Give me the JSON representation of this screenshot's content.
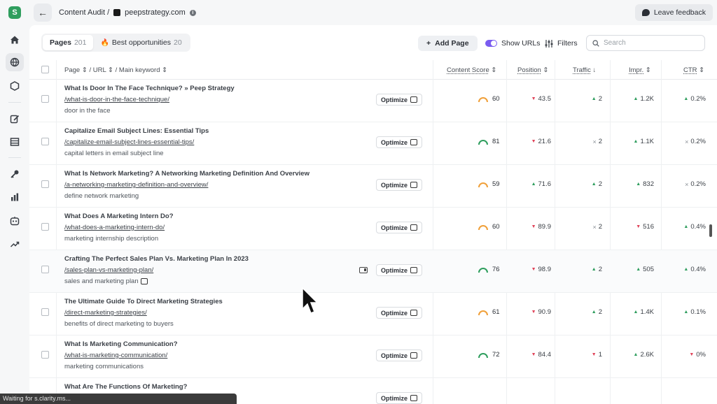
{
  "header": {
    "crumb_root": "Content Audit /",
    "site": "peepstrategy.com",
    "feedback_label": "Leave feedback"
  },
  "rail": {
    "logo_letter": "S",
    "icons": [
      "home-icon",
      "globe-icon",
      "hexagon-icon",
      "edit-icon",
      "table-icon",
      "key-icon",
      "bar-chart-icon",
      "robot-icon",
      "trend-icon"
    ]
  },
  "toolbar": {
    "tabs": [
      {
        "label": "Pages",
        "count": "201"
      },
      {
        "label": "Best opportunities",
        "count": "20"
      }
    ],
    "add_page": "Add Page",
    "show_urls": "Show URLs",
    "filters": "Filters",
    "search_placeholder": "Search"
  },
  "columns": {
    "page": "Page",
    "url": "/ URL",
    "keyword": "/ Main keyword",
    "content_score": "Content Score",
    "position": "Position",
    "traffic": "Traffic",
    "impr": "Impr.",
    "ctr": "CTR"
  },
  "optimize_label": "Optimize",
  "rows": [
    {
      "title": "What Is Door In The Face Technique? » Peep Strategy",
      "url": "/what-is-door-in-the-face-technique/",
      "keyword": "door in the face",
      "score": "60",
      "score_color": "#f0a03a",
      "position": "43.5",
      "pos_dir": "down",
      "traffic": "2",
      "traffic_dir": "up",
      "impr": "1.2K",
      "impr_dir": "up",
      "ctr": "0.2%",
      "ctr_dir": "up"
    },
    {
      "title": "Capitalize Email Subject Lines: Essential Tips",
      "url": "/capitalize-email-subject-lines-essential-tips/",
      "keyword": "capital letters in email subject line",
      "score": "81",
      "score_color": "#2f9e5e",
      "position": "21.6",
      "pos_dir": "down",
      "traffic": "2",
      "traffic_dir": "eq",
      "impr": "1.1K",
      "impr_dir": "up",
      "ctr": "0.2%",
      "ctr_dir": "eq"
    },
    {
      "title": "What Is Network Marketing? A Networking Marketing Definition And Overview",
      "url": "/a-networking-marketing-definition-and-overview/",
      "keyword": "define network marketing",
      "score": "59",
      "score_color": "#f0a03a",
      "position": "71.6",
      "pos_dir": "up",
      "traffic": "2",
      "traffic_dir": "up",
      "impr": "832",
      "impr_dir": "up",
      "ctr": "0.2%",
      "ctr_dir": "eq"
    },
    {
      "title": "What Does A Marketing Intern Do?",
      "url": "/what-does-a-marketing-intern-do/",
      "keyword": "marketing internship description",
      "score": "60",
      "score_color": "#f0a03a",
      "position": "89.9",
      "pos_dir": "down",
      "traffic": "2",
      "traffic_dir": "eq",
      "impr": "516",
      "impr_dir": "down",
      "ctr": "0.4%",
      "ctr_dir": "up"
    },
    {
      "title": "Crafting The Perfect Sales Plan Vs. Marketing Plan In 2023",
      "url": "/sales-plan-vs-marketing-plan/",
      "keyword": "sales and marketing plan",
      "score": "76",
      "score_color": "#2f9e5e",
      "position": "98.9",
      "pos_dir": "down",
      "traffic": "2",
      "traffic_dir": "up",
      "impr": "505",
      "impr_dir": "up",
      "ctr": "0.4%",
      "ctr_dir": "up",
      "hovered": true
    },
    {
      "title": "The Ultimate Guide To Direct Marketing Strategies",
      "url": "/direct-marketing-strategies/",
      "keyword": "benefits of direct marketing to buyers",
      "score": "61",
      "score_color": "#f0a03a",
      "position": "90.9",
      "pos_dir": "down",
      "traffic": "2",
      "traffic_dir": "up",
      "impr": "1.4K",
      "impr_dir": "up",
      "ctr": "0.1%",
      "ctr_dir": "up"
    },
    {
      "title": "What Is Marketing Communication?",
      "url": "/what-is-marketing-communication/",
      "keyword": "marketing communications",
      "score": "72",
      "score_color": "#2f9e5e",
      "position": "84.4",
      "pos_dir": "down",
      "traffic": "1",
      "traffic_dir": "down",
      "impr": "2.6K",
      "impr_dir": "up",
      "ctr": "0%",
      "ctr_dir": "down"
    },
    {
      "title": "What Are The Functions Of Marketing?",
      "url": "",
      "keyword": "",
      "score": "",
      "score_color": "#2f9e5e",
      "position": "",
      "pos_dir": "",
      "traffic": "",
      "traffic_dir": "",
      "impr": "",
      "impr_dir": "",
      "ctr": "",
      "ctr_dir": ""
    }
  ],
  "status_bar": "Waiting for s.clarity.ms..."
}
